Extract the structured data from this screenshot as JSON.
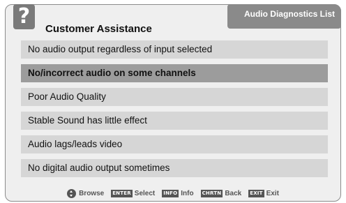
{
  "header": {
    "help_glyph": "?",
    "help_icon": "question-mark-icon",
    "title": "Customer Assistance",
    "tab_label": "Audio Diagnostics List"
  },
  "menu": {
    "selected_index": 1,
    "items": [
      {
        "label": "No audio output regardless of input selected"
      },
      {
        "label": "No/incorrect audio on some channels"
      },
      {
        "label": "Poor Audio Quality"
      },
      {
        "label": "Stable Sound has little effect"
      },
      {
        "label": "Audio lags/leads video"
      },
      {
        "label": "No digital audio output sometimes"
      }
    ]
  },
  "footer": {
    "browse_icon": "dpad-up-down-icon",
    "browse_label": "Browse",
    "enter_key": "ENTER",
    "select_label": "Select",
    "info_key": "INFO",
    "info_label": "Info",
    "chrtn_key": "CHRTN",
    "back_label": "Back",
    "exit_key": "EXIT",
    "exit_label": "Exit"
  },
  "colors": {
    "panel_bg": "#efefef",
    "item_bg": "#d6d6d6",
    "selected_bg": "#9c9c9c",
    "tab_bg": "#8a8a8a"
  }
}
